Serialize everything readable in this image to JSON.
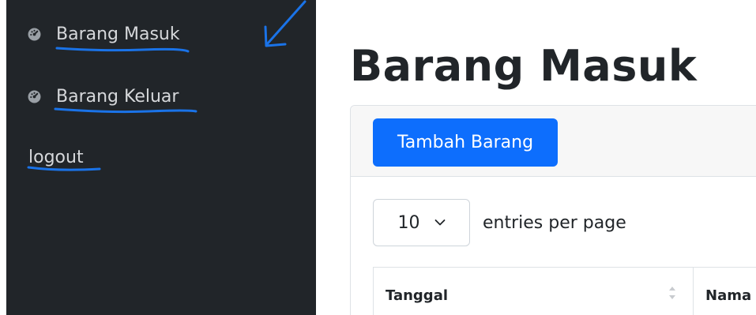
{
  "sidebar": {
    "items": [
      {
        "label": "Barang Masuk",
        "icon": "dashboard-gauge-icon"
      },
      {
        "label": "Barang Keluar",
        "icon": "dashboard-gauge-icon"
      }
    ],
    "logout_label": "logout"
  },
  "main": {
    "title": "Barang Masuk",
    "add_button_label": "Tambah Barang",
    "entries": {
      "selected_value": "10",
      "label": "entries per page"
    },
    "table": {
      "columns": [
        "Tanggal",
        "Nama"
      ]
    }
  },
  "colors": {
    "sidebar_bg": "#212529",
    "primary": "#0d6efd",
    "annotation": "#1a73e8"
  }
}
